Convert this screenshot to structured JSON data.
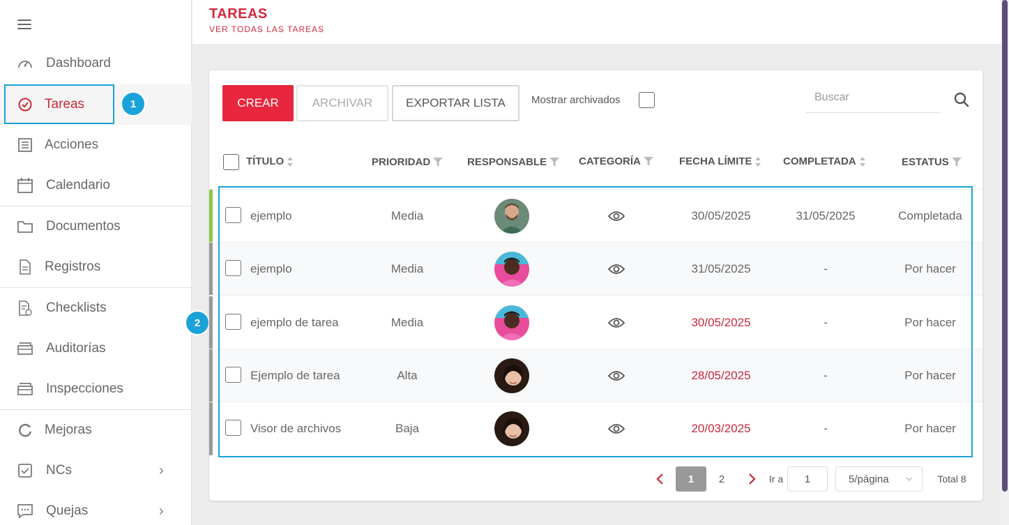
{
  "sidebar": {
    "menu_icon": "hamburger-icon",
    "items": [
      {
        "label": "Dashboard",
        "icon": "gauge-icon"
      },
      {
        "label": "Tareas",
        "icon": "check-circle-icon",
        "active": true
      },
      {
        "label": "Acciones",
        "icon": "list-icon"
      },
      {
        "label": "Calendario",
        "icon": "calendar-icon"
      },
      {
        "label": "Documentos",
        "icon": "folder-icon"
      },
      {
        "label": "Registros",
        "icon": "file-icon"
      },
      {
        "label": "Checklists",
        "icon": "checklist-icon"
      },
      {
        "label": "Auditorías",
        "icon": "box-icon"
      },
      {
        "label": "Inspecciones",
        "icon": "box-icon"
      },
      {
        "label": "Mejoras",
        "icon": "refresh-icon"
      },
      {
        "label": "NCs",
        "icon": "checkbox-icon",
        "has_submenu": true
      },
      {
        "label": "Quejas",
        "icon": "chat-icon",
        "has_submenu": true
      }
    ]
  },
  "callouts": {
    "one": "1",
    "two": "2"
  },
  "header": {
    "title": "TAREAS",
    "subtitle": "VER TODAS LAS TAREAS"
  },
  "toolbar": {
    "crear": "CREAR",
    "archivar": "ARCHIVAR",
    "exportar": "EXPORTAR LISTA",
    "mostrar_archivados": "Mostrar archivados",
    "search_placeholder": "Buscar"
  },
  "table": {
    "columns": [
      "TÍTULO",
      "PRIORIDAD",
      "RESPONSABLE",
      "CATEGORÍA",
      "FECHA LÍMITE",
      "COMPLETADA",
      "ESTATUS"
    ],
    "rows": [
      {
        "titulo": "ejemplo",
        "prioridad": "Media",
        "avatar": "avatar-man-beard",
        "categoria": "eye-icon",
        "fecha": "30/05/2025",
        "fecha_overdue": false,
        "completada": "31/05/2025",
        "estatus": "Completada",
        "bar_color": "#8cc63f"
      },
      {
        "titulo": "ejemplo",
        "prioridad": "Media",
        "avatar": "avatar-man-colorful",
        "categoria": "eye-icon",
        "fecha": "31/05/2025",
        "fecha_overdue": false,
        "completada": "-",
        "estatus": "Por hacer",
        "bar_color": "#999999"
      },
      {
        "titulo": "ejemplo de tarea",
        "prioridad": "Media",
        "avatar": "avatar-man-colorful",
        "categoria": "eye-icon",
        "fecha": "30/05/2025",
        "fecha_overdue": true,
        "completada": "-",
        "estatus": "Por hacer",
        "bar_color": "#999999"
      },
      {
        "titulo": "Ejemplo de tarea",
        "prioridad": "Alta",
        "avatar": "avatar-woman",
        "categoria": "eye-icon",
        "fecha": "28/05/2025",
        "fecha_overdue": true,
        "completada": "-",
        "estatus": "Por hacer",
        "bar_color": "#999999"
      },
      {
        "titulo": "Visor de archivos",
        "prioridad": "Baja",
        "avatar": "avatar-woman",
        "categoria": "eye-icon",
        "fecha": "20/03/2025",
        "fecha_overdue": true,
        "completada": "-",
        "estatus": "Por hacer",
        "bar_color": "#999999"
      }
    ]
  },
  "pagination": {
    "pages": [
      "1",
      "2"
    ],
    "current": "1",
    "goto_label": "Ir a",
    "goto_value": "1",
    "page_size": "5/página",
    "total": "Total 8"
  },
  "colors": {
    "accent": "#e8273e",
    "overdue": "#c8283b",
    "callout": "#1aa3d9",
    "complete_bar": "#8cc63f"
  }
}
